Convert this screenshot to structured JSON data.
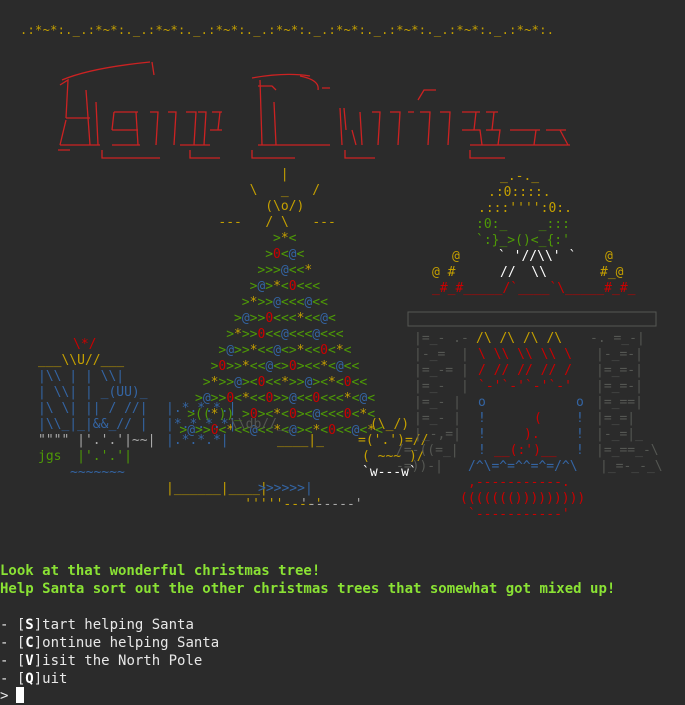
{
  "garland": ".:*~*:._.:*~*:._.:*~*:._.:*~*:._.:*~*:._.:*~*:._.:*~*:._.:*~*:._.:*~*:.",
  "title_art": [
    "  _______)     ________                 ",
    " (, /    /    (, /   )          _/_     ",
    "   /  __    ___  /    __    _       /      ",
    " _/ _ /  _ _(/_ (_/  _ /  (_  (/_      ",
    "(___ __)   (______/        (___)    "
  ],
  "art_lines": [
    {
      "text": "                                    |",
      "color": "#c5a000"
    },
    {
      "text": "                                \\   _   /",
      "color": "#c5a000"
    },
    {
      "text": "                                  (\\o/)",
      "color": "#c5a000"
    },
    {
      "text": "                            ---   / \\   ---",
      "color": "#c5a000"
    },
    {
      "text": "                                   >*<",
      "color": "#4e9a06"
    },
    {
      "text": "                                  >0<@<",
      "color": "#4e9a06"
    },
    {
      "text": "                                 >>>@<<*",
      "color": "#4e9a06"
    },
    {
      "text": "                                >@>*<0<<<",
      "color": "#4e9a06"
    },
    {
      "text": "                               >*>>@<<<@<<",
      "color": "#4e9a06"
    },
    {
      "text": "                              >@>>0<<<*<<@<",
      "color": "#4e9a06"
    },
    {
      "text": "                             >*>>0<<@<<<@<<<",
      "color": "#4e9a06"
    },
    {
      "text": "                            >@>>*<<@<>*<<0<*<",
      "color": "#4e9a06"
    },
    {
      "text": "                           >0>>*<<@<>0><<*<@<<",
      "color": "#4e9a06"
    },
    {
      "text": "                          >*>>@><0<<*>>@><*<0<<",
      "color": "#4e9a06"
    },
    {
      "text": "                         >@>>0<*<<0>>@<<0<<<*<@<",
      "color": "#4e9a06"
    },
    {
      "text": "                        >((*))_>0><*<0><@<<<0<*<",
      "color": "#4e9a06"
    },
    {
      "text": "                       >@>>0<*<<@<<*<@><*<0<<@<*<",
      "color": "#4e9a06"
    }
  ],
  "messages": {
    "line1": "Look at that wonderful christmas tree!",
    "line2": "Help Santa sort out the other christmas trees that somewhat got mixed up!"
  },
  "menu": [
    {
      "prefix": "- [",
      "key": "S",
      "suffix": "]tart helping Santa"
    },
    {
      "prefix": "- [",
      "key": "C",
      "suffix": "]ontinue helping Santa"
    },
    {
      "prefix": "- [",
      "key": "V",
      "suffix": "]isit the North Pole"
    },
    {
      "prefix": "- [",
      "key": "Q",
      "suffix": "]uit"
    }
  ],
  "prompt": ">",
  "signature": "jgs",
  "colors": {
    "background": "#2b2b2b",
    "garland": "#c5a000",
    "title": "#cc2222",
    "tree": "#4e9a06",
    "star": "#c5a000",
    "message": "#8ae234",
    "menu": "#e8e8e8",
    "fireplace": "#555753",
    "santa": "#4e9a06",
    "gifts_blue": "#3465a4",
    "gifts_red": "#cc0000",
    "snowman_yellow": "#c5a000"
  }
}
